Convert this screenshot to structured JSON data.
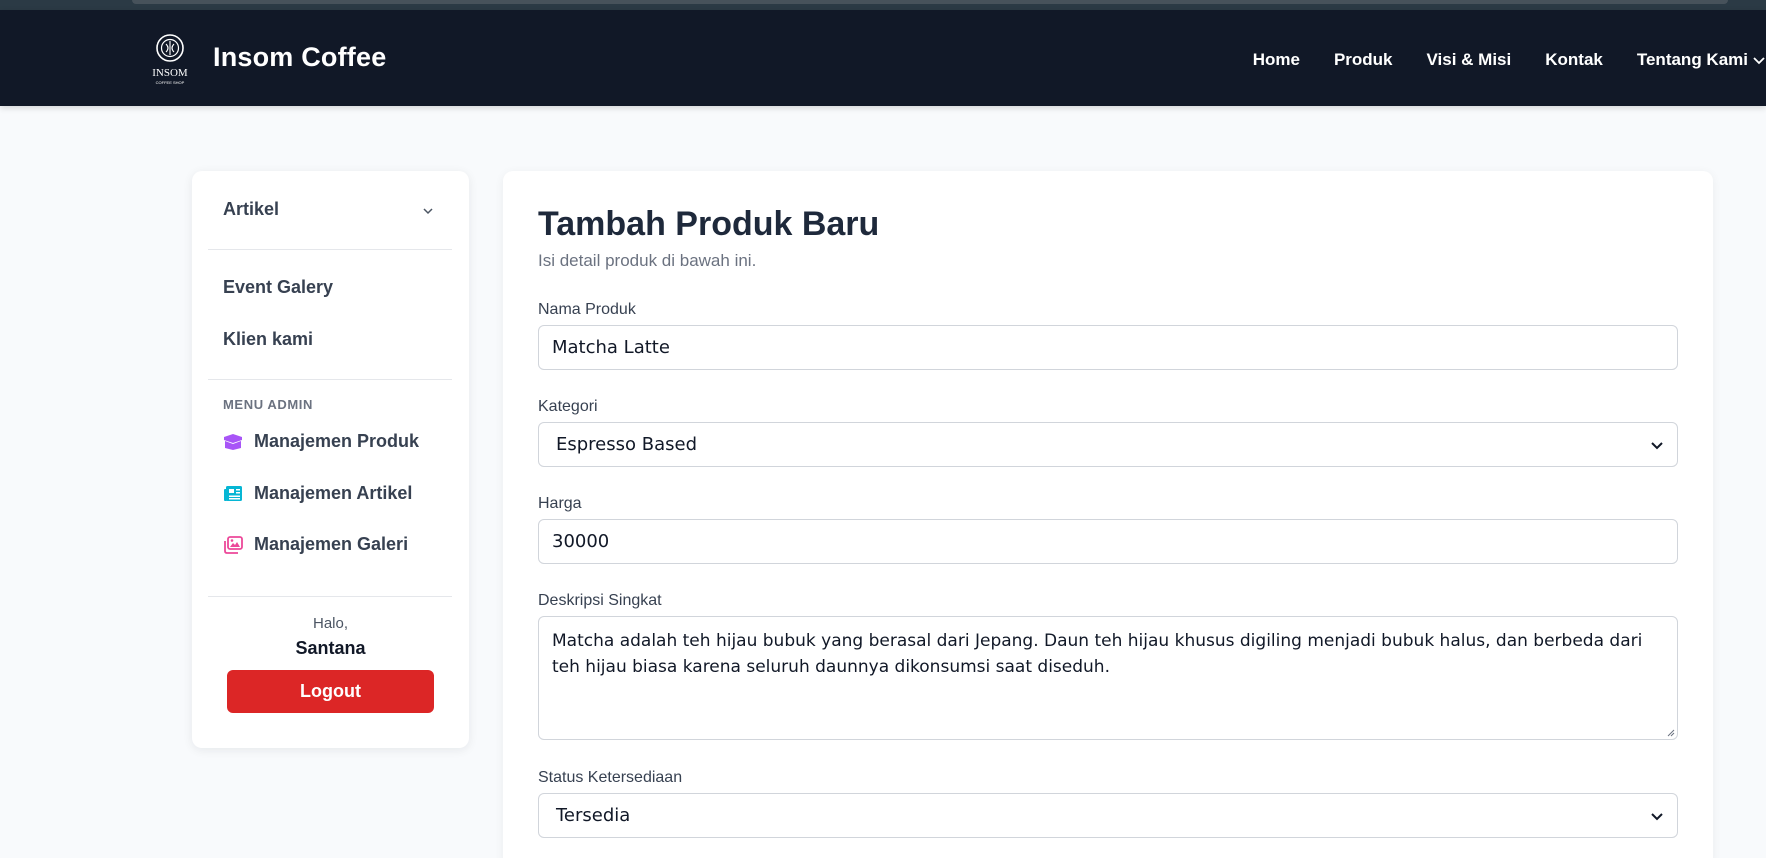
{
  "brand": {
    "name": "Insom Coffee",
    "logo_text": "INSOM",
    "logo_subtext": "COFFEE SHOP"
  },
  "nav": {
    "items": [
      {
        "label": "Home"
      },
      {
        "label": "Produk"
      },
      {
        "label": "Visi & Misi"
      },
      {
        "label": "Kontak"
      },
      {
        "label": "Tentang Kami"
      }
    ]
  },
  "sidebar": {
    "artikel": "Artikel",
    "event_galery": "Event Galery",
    "klien_kami": "Klien kami",
    "admin_title": "MENU ADMIN",
    "admin_items": [
      {
        "label": "Manajemen Produk",
        "icon": "box-icon",
        "color": "#a855f7"
      },
      {
        "label": "Manajemen Artikel",
        "icon": "newspaper-icon",
        "color": "#06b6d4"
      },
      {
        "label": "Manajemen Galeri",
        "icon": "images-icon",
        "color": "#ec4899"
      }
    ],
    "greeting": "Halo,",
    "user_name": "Santana",
    "logout_label": "Logout"
  },
  "form": {
    "title": "Tambah Produk Baru",
    "subtitle": "Isi detail produk di bawah ini.",
    "nama_label": "Nama Produk",
    "nama_value": "Matcha Latte",
    "kategori_label": "Kategori",
    "kategori_value": "Espresso Based",
    "harga_label": "Harga",
    "harga_value": "30000",
    "deskripsi_label": "Deskripsi Singkat",
    "deskripsi_value": "Matcha adalah teh hijau bubuk yang berasal dari Jepang. Daun teh hijau khusus digiling menjadi bubuk halus, dan berbeda dari teh hijau biasa karena seluruh daunnya dikonsumsi saat diseduh.",
    "status_label": "Status Ketersediaan",
    "status_value": "Tersedia"
  },
  "colors": {
    "navbar": "#111827",
    "logout": "#dc2626",
    "background": "#f8fafc"
  }
}
